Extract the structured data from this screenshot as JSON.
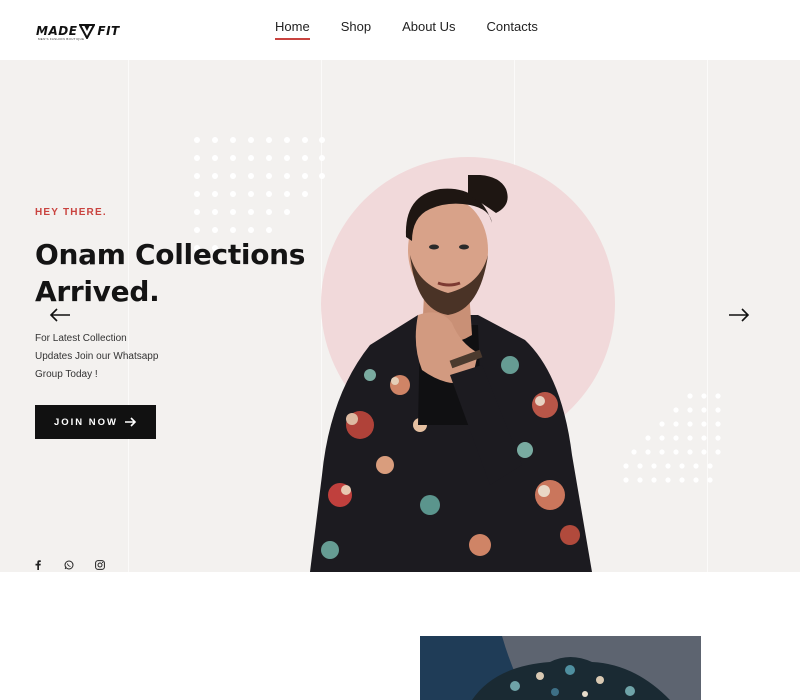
{
  "brand": {
    "word_left": "MADE",
    "word_right": "FIT",
    "tagline": "MEN'S FASHION BOUTIQUE",
    "accent_color": "#c9433f"
  },
  "nav": {
    "items": [
      {
        "label": "Home",
        "active": true
      },
      {
        "label": "Shop",
        "active": false
      },
      {
        "label": "About Us",
        "active": false
      },
      {
        "label": "Contacts",
        "active": false
      }
    ]
  },
  "hero": {
    "eyebrow": "HEY THERE.",
    "headline_line1": "Onam Collections",
    "headline_line2": "Arrived.",
    "lead_line1": "For Latest Collection",
    "lead_line2": "Updates Join our Whatsapp",
    "lead_line3": "Group Today !",
    "cta_label": "JOIN NOW",
    "cta_icon": "arrow-right-icon",
    "prev_icon": "arrow-left-icon",
    "next_icon": "arrow-right-icon",
    "background_color": "#f3f1ef",
    "circle_color": "#f1d9da"
  },
  "social": {
    "icons": [
      "facebook-icon",
      "whatsapp-icon",
      "instagram-icon"
    ]
  }
}
